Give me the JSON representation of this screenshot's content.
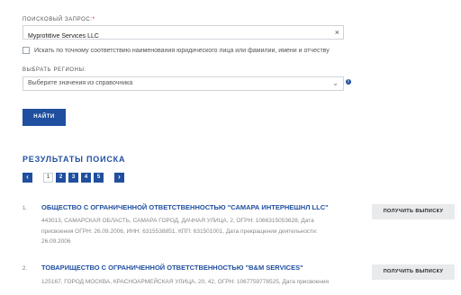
{
  "form": {
    "query_label": "ПОИСКОВЫЙ ЗАПРОС:",
    "query_required_mark": "*",
    "query_value": "Myprofitlive Services LLC",
    "clear_icon": "×",
    "exact_match_label": "Искать по точному соответствию наименования юридического лица или фамилии, имени и отчеству",
    "exact_match_checked": false,
    "regions_label": "ВЫБРАТЬ РЕГИОНЫ:",
    "regions_placeholder": "Выберите значения из справочника",
    "regions_chevron": "⌄",
    "info_icon": "i",
    "find_button": "НАЙТИ"
  },
  "results": {
    "title": "РЕЗУЛЬТАТЫ ПОИСКА",
    "pagination": {
      "prev": "‹",
      "next": "›",
      "pages": [
        "1",
        "2",
        "3",
        "4",
        "5"
      ],
      "current": "1"
    },
    "items": [
      {
        "num": "1.",
        "title": "ОБЩЕСТВО С ОГРАНИЧЕННОЙ ОТВЕТСТВЕННОСТЬЮ \"САМАРА ИНТЕРНЕШНЛ LLC\"",
        "desc": "443013, САМАРСКАЯ ОБЛАСТЬ, САМАРА ГОРОД, ДАЧНАЯ УЛИЦА, 2, ОГРН: 1066315053628, Дата присвоения ОГРН: 26.09.2006, ИНН: 6315538851, КПП: 631501001, Дата прекращения деятельности: 26.09.2006",
        "button": "ПОЛУЧИТЬ ВЫПИСКУ"
      },
      {
        "num": "2.",
        "title": "ТОВАРИЩЕСТВО С ОГРАНИЧЕННОЙ ОТВЕТСТВЕННОСТЬЮ \"B&M SERVICES\"",
        "desc": "125167, ГОРОД МОСКВА, КРАСНОАРМЕЙСКАЯ УЛИЦА, 20, 42, ОГРН: 1067759778525, Дата присвоения",
        "button": "ПОЛУЧИТЬ ВЫПИСКУ"
      }
    ]
  },
  "colors": {
    "accent": "#1f4f9e",
    "required": "#c8102e",
    "button_grey": "#e9eaec"
  }
}
